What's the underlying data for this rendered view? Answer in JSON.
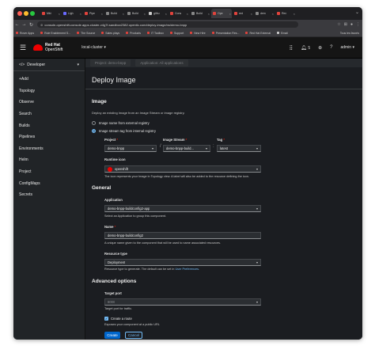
{
  "browser": {
    "tabs": [
      {
        "label": "Mkt",
        "favicon": "#e0433c"
      },
      {
        "label": "Ligh",
        "favicon": "#6a6aff"
      },
      {
        "label": "Pipe",
        "favicon": "#e0433c"
      },
      {
        "label": "Build",
        "favicon": "#888888"
      },
      {
        "label": "Build",
        "favicon": "#888888"
      },
      {
        "label": "githu",
        "favicon": "#cccccc"
      },
      {
        "label": "Cons",
        "favicon": "#e0433c"
      },
      {
        "label": "Build",
        "favicon": "#888888"
      },
      {
        "label": "Ope",
        "favicon": "#e0433c",
        "active": true
      },
      {
        "label": "red",
        "favicon": "#e0433c"
      },
      {
        "label": "dem",
        "favicon": "#888888"
      },
      {
        "label": "Red",
        "favicon": "#e0433c"
      }
    ],
    "url": "console-openshift-console.apps.cluster-v4g7t.sandbox2382.opentlc.com/deploy-image/ns/demo-bnpp",
    "bookmarks": [
      {
        "label": "Rover Apps",
        "color": "#e0433c"
      },
      {
        "label": "Role Enablement S...",
        "color": "#e0433c"
      },
      {
        "label": "The Source",
        "color": "#e0433c"
      },
      {
        "label": "Sales plays",
        "color": "#e0433c"
      },
      {
        "label": "Products",
        "color": "#e0433c"
      },
      {
        "label": "IT Toolbox",
        "color": "#e0433c"
      },
      {
        "label": "Support",
        "color": "#e0433c"
      },
      {
        "label": "New Hire",
        "color": "#e0433c"
      },
      {
        "label": "Presentation Res...",
        "color": "#e0433c"
      },
      {
        "label": "Red Hat External",
        "color": "#e0433c"
      },
      {
        "label": "Email",
        "color": "#cccccc"
      }
    ],
    "bookmarks_right": "Tous les favoris"
  },
  "masthead": {
    "brand_line1": "Red Hat",
    "brand_line2": "OpenShift",
    "cluster": "local-cluster",
    "notifications_count": "5",
    "user": "admin"
  },
  "sidebar": {
    "perspective": "Developer",
    "items": [
      "+Add",
      "Topology",
      "Observe",
      "Search",
      "Builds",
      "Pipelines",
      "Environments",
      "Helm",
      "Project",
      "ConfigMaps",
      "Secrets"
    ]
  },
  "context_tabs": [
    "Project: demo-bnpp",
    "Application: All applications"
  ],
  "page": {
    "title": "Deploy Image",
    "image_section": "Image",
    "image_desc": "Deploy an existing Image from an Image Stream or image registry.",
    "radio_external": "Image name from external registry",
    "radio_internal": "Image stream tag from internal registry",
    "project_label": "Project",
    "project_value": "demo-bnpp",
    "imagestream_label": "Image Stream",
    "imagestream_value": "demo-bnpp-build...",
    "tag_label": "Tag",
    "tag_value": "latest",
    "runtime_icon_label": "Runtime icon",
    "runtime_icon_value": "openshift",
    "runtime_icon_helper": "The icon represents your Image in Topology view. A label will also be added to the resource defining the icon.",
    "general_section": "General",
    "application_label": "Application",
    "application_value": "demo-bnpp-buildconfig2-app",
    "application_helper": "Select an Application to group this component.",
    "name_label": "Name",
    "name_value": "demo-bnpp-buildconfig2",
    "name_helper": "A unique name given to the component that will be used to name associated resources.",
    "resource_type_label": "Resource type",
    "resource_type_value": "Deployment",
    "resource_type_helper_prefix": "Resource type to generate. The default can be set in ",
    "resource_type_helper_link": "User Preferences",
    "advanced_section": "Advanced options",
    "target_port_label": "Target port",
    "target_port_value": "8000",
    "target_port_helper": "Target port for traffic.",
    "create_route_label": "Create a route",
    "create_route_helper": "Exposes your component at a public URL",
    "create_button": "Create",
    "cancel_button": "Cancel"
  },
  "colors": {
    "accent": "#73bcf7",
    "primary_button": "#0066cc",
    "brand_red": "#ee0000"
  }
}
